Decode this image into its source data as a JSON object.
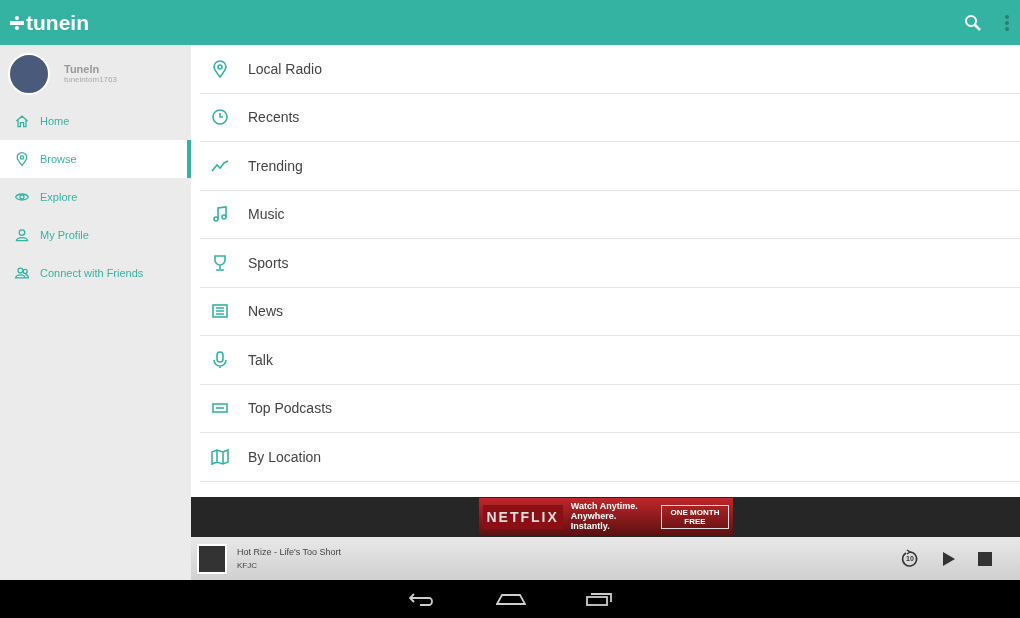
{
  "app_bar": {
    "logo": "tunein"
  },
  "sidebar": {
    "profile": {
      "name": "TuneIn",
      "username": "tuneintom1763"
    },
    "items": [
      {
        "label": "Home",
        "selected": false
      },
      {
        "label": "Browse",
        "selected": true
      },
      {
        "label": "Explore",
        "selected": false
      },
      {
        "label": "My Profile",
        "selected": false
      },
      {
        "label": "Connect with Friends",
        "selected": false
      }
    ]
  },
  "browse_list": [
    {
      "label": "Local Radio"
    },
    {
      "label": "Recents"
    },
    {
      "label": "Trending"
    },
    {
      "label": "Music"
    },
    {
      "label": "Sports"
    },
    {
      "label": "News"
    },
    {
      "label": "Talk"
    },
    {
      "label": "Top Podcasts"
    },
    {
      "label": "By Location"
    }
  ],
  "ad": {
    "brand": "NETFLIX",
    "line_1": "Watch Anytime.",
    "line_2": "Anywhere. Instantly.",
    "offer": "ONE MONTH FREE"
  },
  "player": {
    "title": "Hot Rize - Life's Too Short",
    "station": "KFJC",
    "replay_seconds": "10"
  }
}
